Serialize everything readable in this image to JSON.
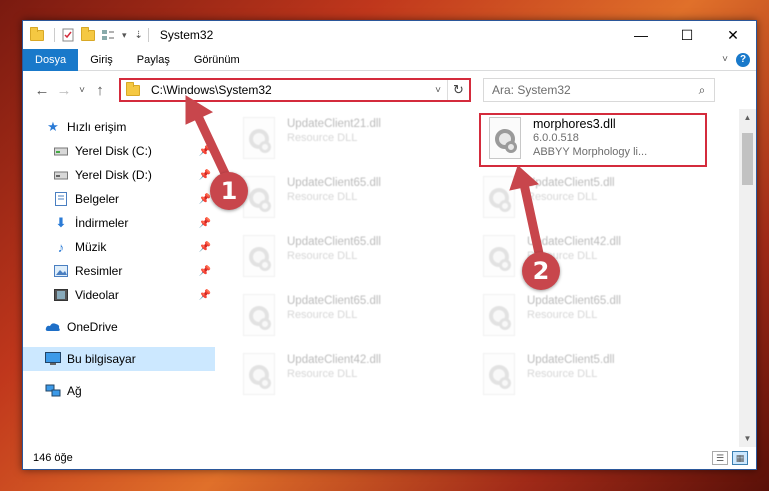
{
  "titlebar": {
    "title": "System32",
    "minimize": "—",
    "maximize": "☐",
    "close": "✕"
  },
  "ribbon": {
    "tabs": [
      "Dosya",
      "Giriş",
      "Paylaş",
      "Görünüm"
    ],
    "active_tab": "Dosya",
    "help": "?"
  },
  "navigation": {
    "back": "←",
    "forward": "→",
    "recent": "˅",
    "up": "↑",
    "address": "C:\\Windows\\System32",
    "refresh": "↻",
    "search_placeholder": "Ara: System32"
  },
  "sidebar": {
    "items": [
      {
        "label": "Hızlı erişim",
        "icon": "star-icon"
      },
      {
        "label": "Yerel Disk (C:)",
        "icon": "drive-icon",
        "pinned": true
      },
      {
        "label": "Yerel Disk (D:)",
        "icon": "drive-icon",
        "pinned": true
      },
      {
        "label": "Belgeler",
        "icon": "documents-icon",
        "pinned": true
      },
      {
        "label": "İndirmeler",
        "icon": "download-icon",
        "pinned": true
      },
      {
        "label": "Müzik",
        "icon": "music-icon",
        "pinned": true
      },
      {
        "label": "Resimler",
        "icon": "pictures-icon",
        "pinned": true
      },
      {
        "label": "Videolar",
        "icon": "videos-icon",
        "pinned": true
      },
      {
        "label": "OneDrive",
        "icon": "cloud-icon"
      },
      {
        "label": "Bu bilgisayar",
        "icon": "computer-icon",
        "selected": true
      },
      {
        "label": "Ağ",
        "icon": "network-icon"
      }
    ]
  },
  "files": {
    "highlighted": {
      "name": "morphores3.dll",
      "version": "6.0.0.518",
      "description": "ABBYY Morphology li..."
    },
    "left_column": [
      {
        "name": "UpdateClient21.dll",
        "type": "Resource DLL"
      },
      {
        "name": "UpdateClient65.dll",
        "type": "Resource DLL"
      },
      {
        "name": "UpdateClient65.dll",
        "type": "Resource DLL"
      },
      {
        "name": "UpdateClient65.dll",
        "type": "Resource DLL"
      },
      {
        "name": "UpdateClient42.dll",
        "type": "Resource DLL"
      }
    ],
    "right_column": [
      {
        "name": "UpdateClient5.dll",
        "type": "Resource DLL"
      },
      {
        "name": "UpdateClient42.dll",
        "type": "Resource DLL"
      },
      {
        "name": "UpdateClient65.dll",
        "type": "Resource DLL"
      },
      {
        "name": "UpdateClient5.dll",
        "type": "Resource DLL"
      }
    ]
  },
  "statusbar": {
    "count": "146 öğe"
  },
  "annotations": {
    "badge1": "1",
    "badge2": "2",
    "color": "#c8464c"
  }
}
